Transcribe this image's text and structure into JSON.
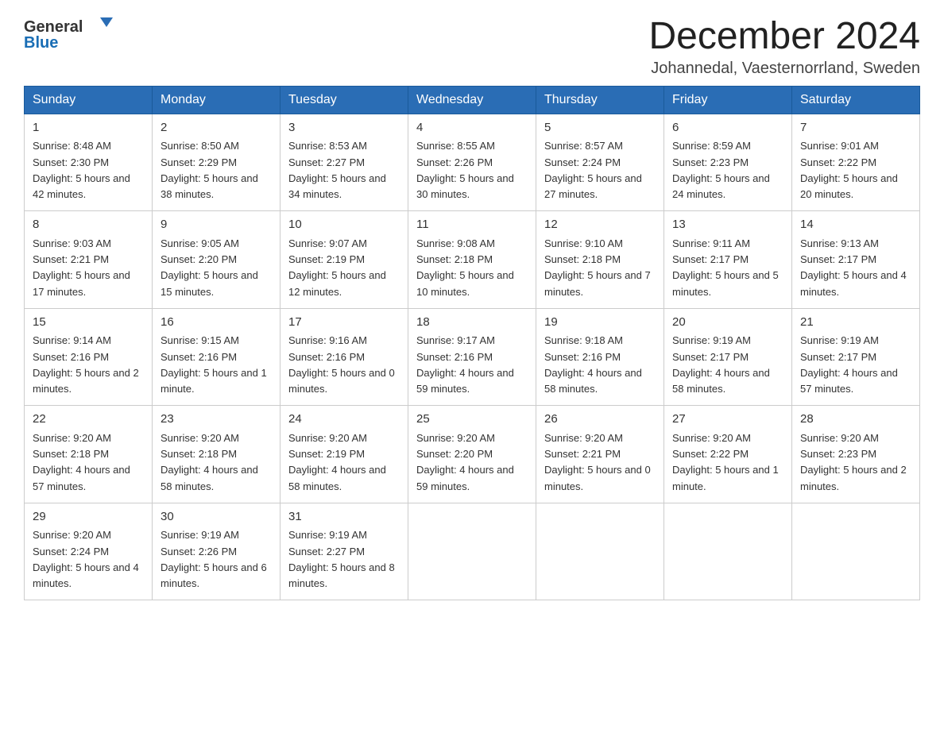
{
  "logo": {
    "text_general": "General",
    "text_blue": "Blue"
  },
  "title": "December 2024",
  "subtitle": "Johannedal, Vaesternorrland, Sweden",
  "weekdays": [
    "Sunday",
    "Monday",
    "Tuesday",
    "Wednesday",
    "Thursday",
    "Friday",
    "Saturday"
  ],
  "weeks": [
    [
      {
        "day": "1",
        "sunrise": "8:48 AM",
        "sunset": "2:30 PM",
        "daylight": "5 hours and 42 minutes."
      },
      {
        "day": "2",
        "sunrise": "8:50 AM",
        "sunset": "2:29 PM",
        "daylight": "5 hours and 38 minutes."
      },
      {
        "day": "3",
        "sunrise": "8:53 AM",
        "sunset": "2:27 PM",
        "daylight": "5 hours and 34 minutes."
      },
      {
        "day": "4",
        "sunrise": "8:55 AM",
        "sunset": "2:26 PM",
        "daylight": "5 hours and 30 minutes."
      },
      {
        "day": "5",
        "sunrise": "8:57 AM",
        "sunset": "2:24 PM",
        "daylight": "5 hours and 27 minutes."
      },
      {
        "day": "6",
        "sunrise": "8:59 AM",
        "sunset": "2:23 PM",
        "daylight": "5 hours and 24 minutes."
      },
      {
        "day": "7",
        "sunrise": "9:01 AM",
        "sunset": "2:22 PM",
        "daylight": "5 hours and 20 minutes."
      }
    ],
    [
      {
        "day": "8",
        "sunrise": "9:03 AM",
        "sunset": "2:21 PM",
        "daylight": "5 hours and 17 minutes."
      },
      {
        "day": "9",
        "sunrise": "9:05 AM",
        "sunset": "2:20 PM",
        "daylight": "5 hours and 15 minutes."
      },
      {
        "day": "10",
        "sunrise": "9:07 AM",
        "sunset": "2:19 PM",
        "daylight": "5 hours and 12 minutes."
      },
      {
        "day": "11",
        "sunrise": "9:08 AM",
        "sunset": "2:18 PM",
        "daylight": "5 hours and 10 minutes."
      },
      {
        "day": "12",
        "sunrise": "9:10 AM",
        "sunset": "2:18 PM",
        "daylight": "5 hours and 7 minutes."
      },
      {
        "day": "13",
        "sunrise": "9:11 AM",
        "sunset": "2:17 PM",
        "daylight": "5 hours and 5 minutes."
      },
      {
        "day": "14",
        "sunrise": "9:13 AM",
        "sunset": "2:17 PM",
        "daylight": "5 hours and 4 minutes."
      }
    ],
    [
      {
        "day": "15",
        "sunrise": "9:14 AM",
        "sunset": "2:16 PM",
        "daylight": "5 hours and 2 minutes."
      },
      {
        "day": "16",
        "sunrise": "9:15 AM",
        "sunset": "2:16 PM",
        "daylight": "5 hours and 1 minute."
      },
      {
        "day": "17",
        "sunrise": "9:16 AM",
        "sunset": "2:16 PM",
        "daylight": "5 hours and 0 minutes."
      },
      {
        "day": "18",
        "sunrise": "9:17 AM",
        "sunset": "2:16 PM",
        "daylight": "4 hours and 59 minutes."
      },
      {
        "day": "19",
        "sunrise": "9:18 AM",
        "sunset": "2:16 PM",
        "daylight": "4 hours and 58 minutes."
      },
      {
        "day": "20",
        "sunrise": "9:19 AM",
        "sunset": "2:17 PM",
        "daylight": "4 hours and 58 minutes."
      },
      {
        "day": "21",
        "sunrise": "9:19 AM",
        "sunset": "2:17 PM",
        "daylight": "4 hours and 57 minutes."
      }
    ],
    [
      {
        "day": "22",
        "sunrise": "9:20 AM",
        "sunset": "2:18 PM",
        "daylight": "4 hours and 57 minutes."
      },
      {
        "day": "23",
        "sunrise": "9:20 AM",
        "sunset": "2:18 PM",
        "daylight": "4 hours and 58 minutes."
      },
      {
        "day": "24",
        "sunrise": "9:20 AM",
        "sunset": "2:19 PM",
        "daylight": "4 hours and 58 minutes."
      },
      {
        "day": "25",
        "sunrise": "9:20 AM",
        "sunset": "2:20 PM",
        "daylight": "4 hours and 59 minutes."
      },
      {
        "day": "26",
        "sunrise": "9:20 AM",
        "sunset": "2:21 PM",
        "daylight": "5 hours and 0 minutes."
      },
      {
        "day": "27",
        "sunrise": "9:20 AM",
        "sunset": "2:22 PM",
        "daylight": "5 hours and 1 minute."
      },
      {
        "day": "28",
        "sunrise": "9:20 AM",
        "sunset": "2:23 PM",
        "daylight": "5 hours and 2 minutes."
      }
    ],
    [
      {
        "day": "29",
        "sunrise": "9:20 AM",
        "sunset": "2:24 PM",
        "daylight": "5 hours and 4 minutes."
      },
      {
        "day": "30",
        "sunrise": "9:19 AM",
        "sunset": "2:26 PM",
        "daylight": "5 hours and 6 minutes."
      },
      {
        "day": "31",
        "sunrise": "9:19 AM",
        "sunset": "2:27 PM",
        "daylight": "5 hours and 8 minutes."
      },
      null,
      null,
      null,
      null
    ]
  ]
}
